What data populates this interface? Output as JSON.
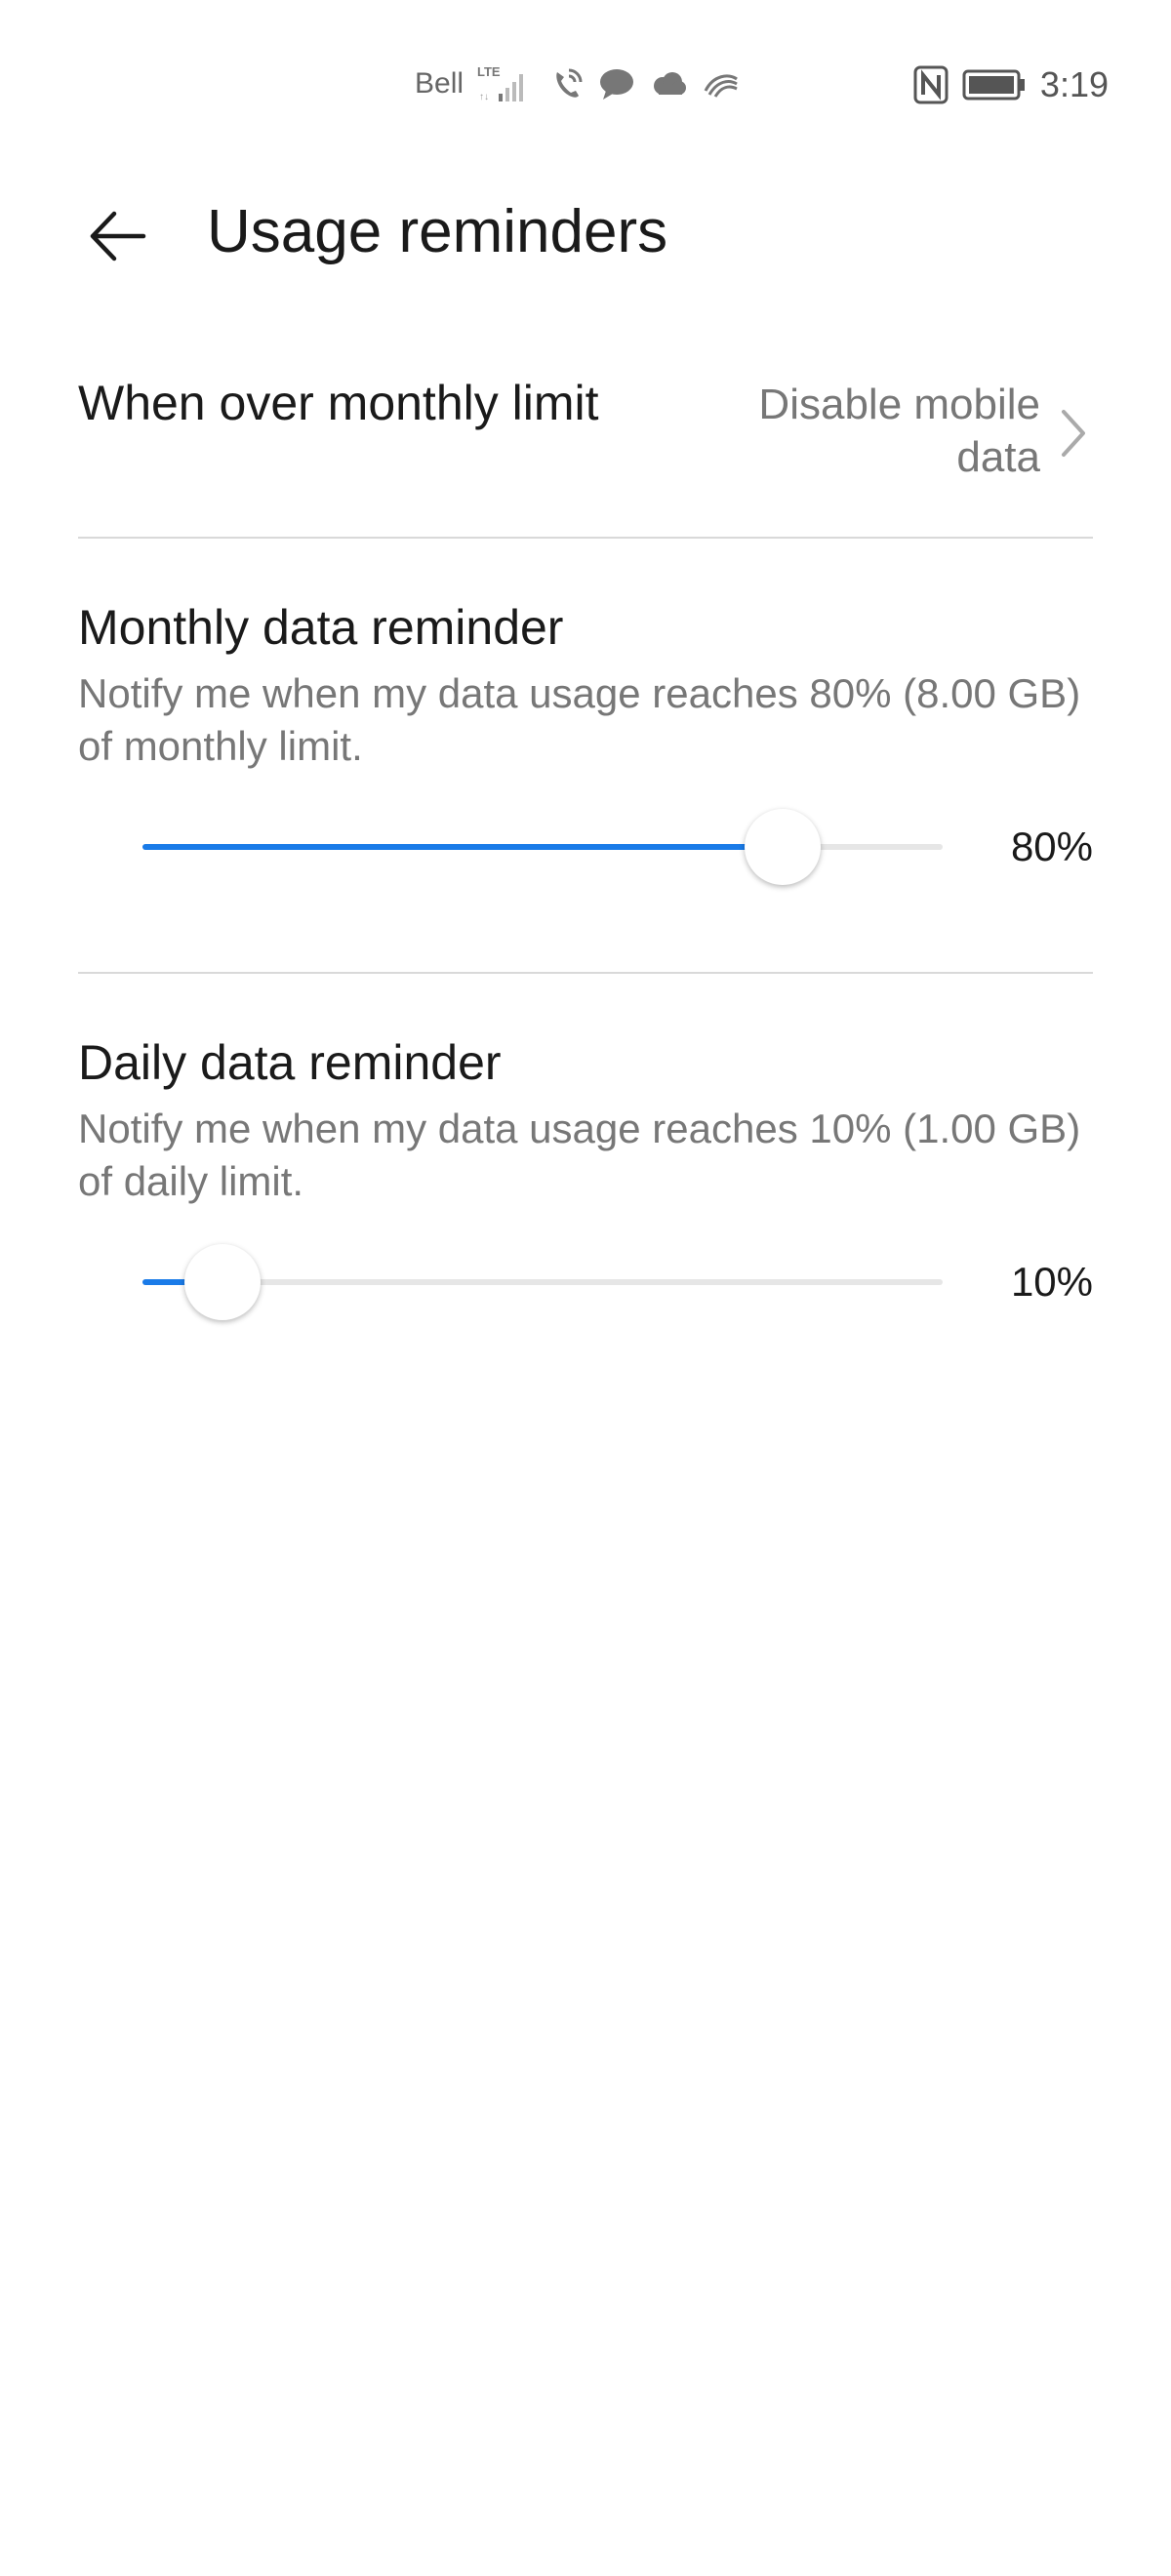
{
  "status_bar": {
    "carrier": "Bell",
    "network_type": "LTE",
    "time": "3:19",
    "icons": [
      "signal-icon",
      "wifi-calling-icon",
      "message-icon",
      "cloud-icon",
      "swiftkey-icon",
      "nfc-icon",
      "battery-icon"
    ]
  },
  "header": {
    "title": "Usage reminders"
  },
  "over_limit": {
    "label": "When over monthly limit",
    "value": "Disable mobile data"
  },
  "monthly": {
    "title": "Monthly data reminder",
    "description": "Notify me when my data usage reaches 80% (8.00 GB) of monthly limit.",
    "value_label": "80%",
    "value": 0.8
  },
  "daily": {
    "title": "Daily data reminder",
    "description": "Notify me when my data usage reaches 10% (1.00 GB) of daily limit.",
    "value_label": "10%",
    "value": 0.1
  },
  "colors": {
    "accent": "#1a7be8",
    "track": "#e6e6e6",
    "secondary_text": "#777777"
  }
}
